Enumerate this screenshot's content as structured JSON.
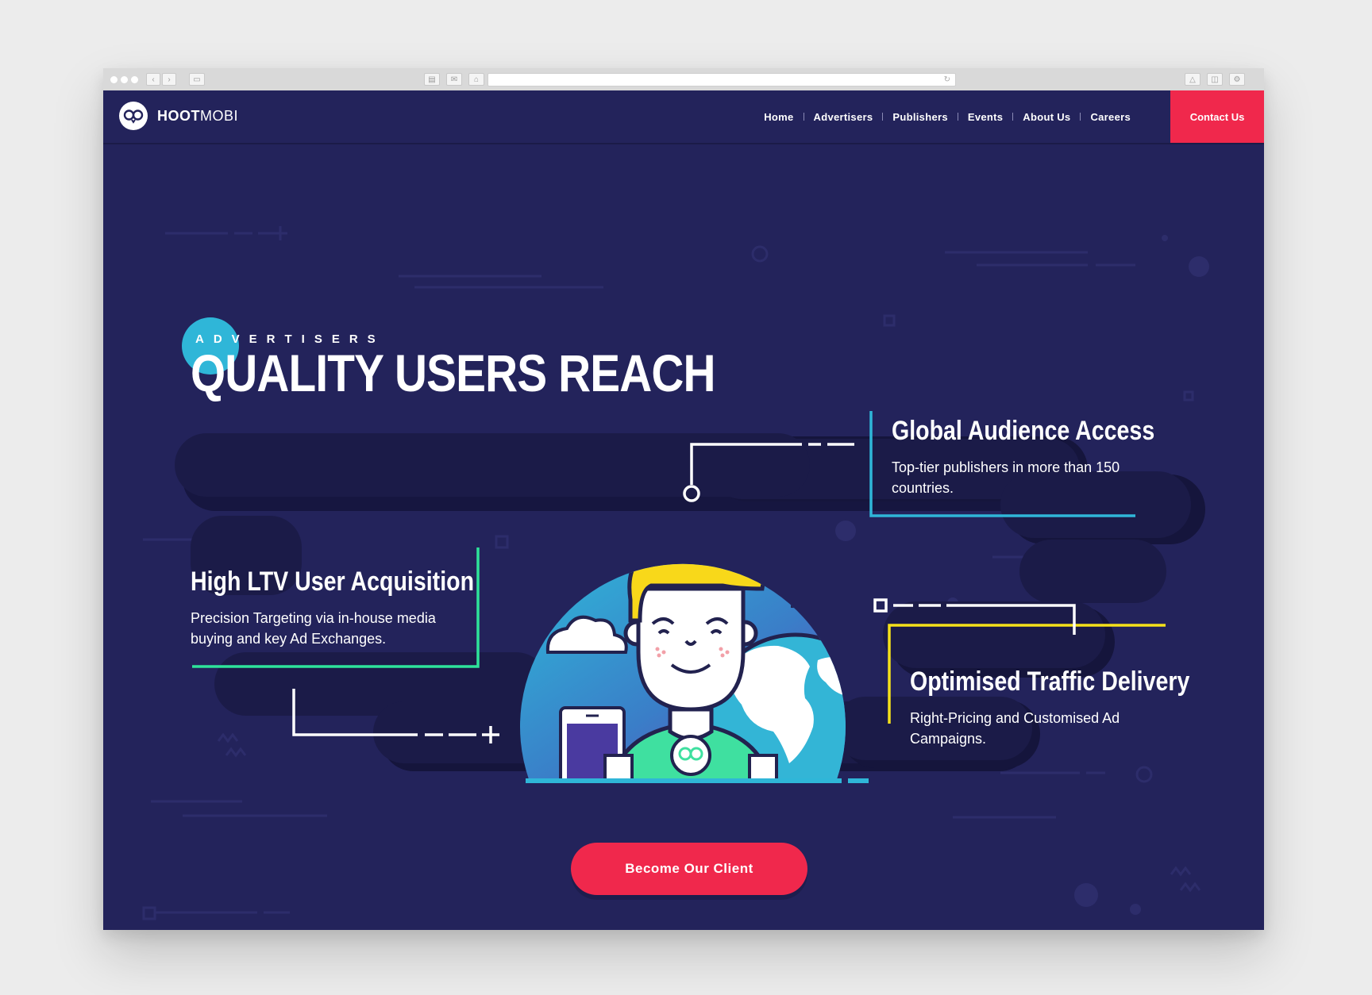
{
  "brand": {
    "logo_bold": "HOOT",
    "logo_light": "MOBI"
  },
  "nav": {
    "items": [
      "Home",
      "Advertisers",
      "Publishers",
      "Events",
      "About Us",
      "Careers"
    ],
    "contact_label": "Contact Us"
  },
  "hero": {
    "eyebrow": "ADVERTISERS",
    "headline": "QUALITY USERS REACH",
    "features": [
      {
        "title": "Global Audience Access",
        "description": "Top-tier publishers in more than 150 countries.",
        "accent": "#2fb6d8"
      },
      {
        "title": "High LTV User Acquisition",
        "description": "Precision Targeting via in-house media buying and key Ad Exchanges.",
        "accent": "#2ee39a"
      },
      {
        "title": "Optimised Traffic Delivery",
        "description": "Right-Pricing and Customised Ad Campaigns.",
        "accent": "#f5e11a"
      }
    ],
    "cta_label": "Become Our Client"
  },
  "colors": {
    "background": "#23235b",
    "band": "#1b1b48",
    "accent_red": "#f0284c",
    "accent_cyan": "#2fb6d8",
    "accent_green": "#2ee39a",
    "accent_yellow": "#f5e11a"
  }
}
